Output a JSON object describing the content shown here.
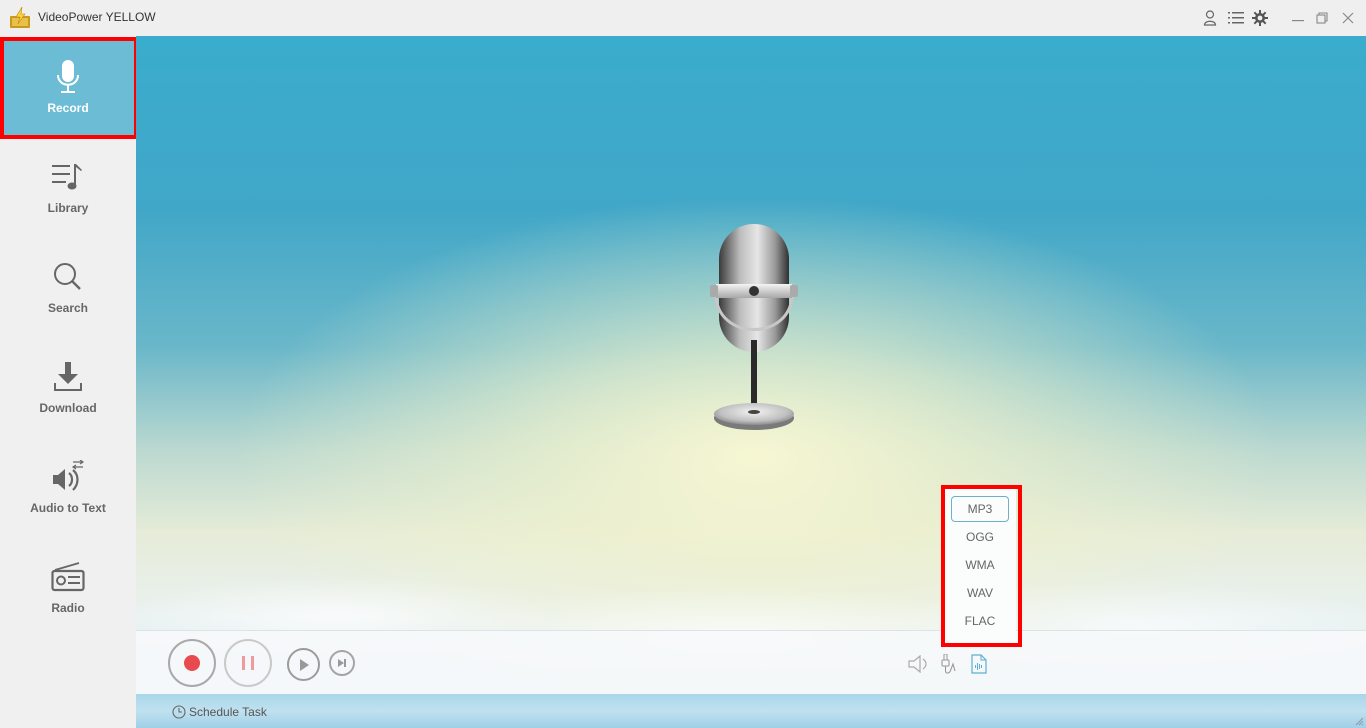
{
  "window": {
    "title": "VideoPower YELLOW",
    "controls": [
      {
        "name": "user-icon",
        "label": "Account"
      },
      {
        "name": "menu-list-icon",
        "label": "Menu"
      },
      {
        "name": "gear-icon",
        "label": "Settings"
      },
      {
        "name": "minimize-icon",
        "label": "Minimize"
      },
      {
        "name": "restore-icon",
        "label": "Restore"
      },
      {
        "name": "close-icon",
        "label": "Close"
      }
    ]
  },
  "sidebar": {
    "items": [
      {
        "label": "Record",
        "icon": "microphone-icon",
        "active": true
      },
      {
        "label": "Library",
        "icon": "music-list-icon",
        "active": false
      },
      {
        "label": "Search",
        "icon": "search-icon",
        "active": false
      },
      {
        "label": "Download",
        "icon": "download-icon",
        "active": false
      },
      {
        "label": "Audio to Text",
        "icon": "speaker-convert-icon",
        "active": false
      },
      {
        "label": "Radio",
        "icon": "radio-icon",
        "active": false
      }
    ]
  },
  "player": {
    "record_label": "Record",
    "pause_label": "Pause",
    "play_label": "Play",
    "next_label": "Next",
    "schedule_label": "Schedule Task",
    "audio_source_icons": [
      "speaker-icon",
      "mic-input-icon",
      "audio-file-icon"
    ]
  },
  "format_menu": {
    "options": [
      "MP3",
      "OGG",
      "WMA",
      "WAV",
      "FLAC"
    ],
    "selected": "MP3"
  },
  "colors": {
    "accent": "#6bbcd4",
    "record_red": "#e84a4f",
    "highlight": "#ff0000"
  }
}
